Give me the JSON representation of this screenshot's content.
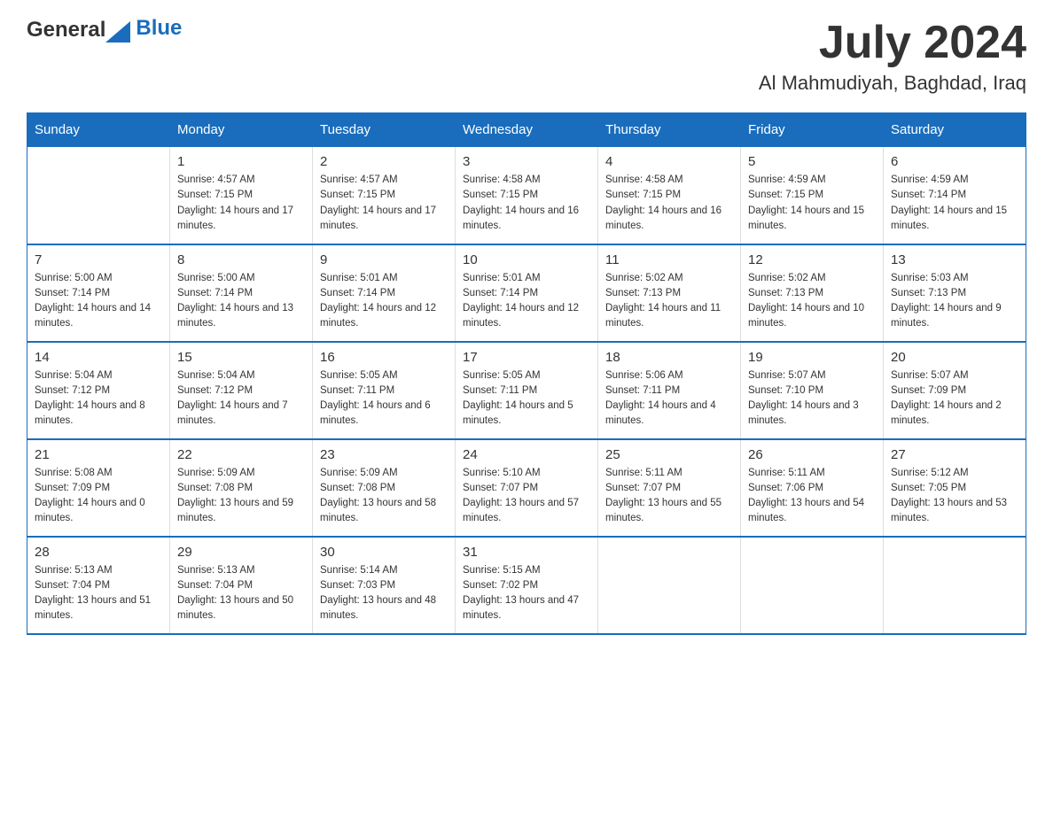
{
  "header": {
    "logo_general": "General",
    "logo_blue": "Blue",
    "month_year": "July 2024",
    "location": "Al Mahmudiyah, Baghdad, Iraq"
  },
  "days_of_week": [
    "Sunday",
    "Monday",
    "Tuesday",
    "Wednesday",
    "Thursday",
    "Friday",
    "Saturday"
  ],
  "weeks": [
    [
      {
        "day": "",
        "sunrise": "",
        "sunset": "",
        "daylight": ""
      },
      {
        "day": "1",
        "sunrise": "Sunrise: 4:57 AM",
        "sunset": "Sunset: 7:15 PM",
        "daylight": "Daylight: 14 hours and 17 minutes."
      },
      {
        "day": "2",
        "sunrise": "Sunrise: 4:57 AM",
        "sunset": "Sunset: 7:15 PM",
        "daylight": "Daylight: 14 hours and 17 minutes."
      },
      {
        "day": "3",
        "sunrise": "Sunrise: 4:58 AM",
        "sunset": "Sunset: 7:15 PM",
        "daylight": "Daylight: 14 hours and 16 minutes."
      },
      {
        "day": "4",
        "sunrise": "Sunrise: 4:58 AM",
        "sunset": "Sunset: 7:15 PM",
        "daylight": "Daylight: 14 hours and 16 minutes."
      },
      {
        "day": "5",
        "sunrise": "Sunrise: 4:59 AM",
        "sunset": "Sunset: 7:15 PM",
        "daylight": "Daylight: 14 hours and 15 minutes."
      },
      {
        "day": "6",
        "sunrise": "Sunrise: 4:59 AM",
        "sunset": "Sunset: 7:14 PM",
        "daylight": "Daylight: 14 hours and 15 minutes."
      }
    ],
    [
      {
        "day": "7",
        "sunrise": "Sunrise: 5:00 AM",
        "sunset": "Sunset: 7:14 PM",
        "daylight": "Daylight: 14 hours and 14 minutes."
      },
      {
        "day": "8",
        "sunrise": "Sunrise: 5:00 AM",
        "sunset": "Sunset: 7:14 PM",
        "daylight": "Daylight: 14 hours and 13 minutes."
      },
      {
        "day": "9",
        "sunrise": "Sunrise: 5:01 AM",
        "sunset": "Sunset: 7:14 PM",
        "daylight": "Daylight: 14 hours and 12 minutes."
      },
      {
        "day": "10",
        "sunrise": "Sunrise: 5:01 AM",
        "sunset": "Sunset: 7:14 PM",
        "daylight": "Daylight: 14 hours and 12 minutes."
      },
      {
        "day": "11",
        "sunrise": "Sunrise: 5:02 AM",
        "sunset": "Sunset: 7:13 PM",
        "daylight": "Daylight: 14 hours and 11 minutes."
      },
      {
        "day": "12",
        "sunrise": "Sunrise: 5:02 AM",
        "sunset": "Sunset: 7:13 PM",
        "daylight": "Daylight: 14 hours and 10 minutes."
      },
      {
        "day": "13",
        "sunrise": "Sunrise: 5:03 AM",
        "sunset": "Sunset: 7:13 PM",
        "daylight": "Daylight: 14 hours and 9 minutes."
      }
    ],
    [
      {
        "day": "14",
        "sunrise": "Sunrise: 5:04 AM",
        "sunset": "Sunset: 7:12 PM",
        "daylight": "Daylight: 14 hours and 8 minutes."
      },
      {
        "day": "15",
        "sunrise": "Sunrise: 5:04 AM",
        "sunset": "Sunset: 7:12 PM",
        "daylight": "Daylight: 14 hours and 7 minutes."
      },
      {
        "day": "16",
        "sunrise": "Sunrise: 5:05 AM",
        "sunset": "Sunset: 7:11 PM",
        "daylight": "Daylight: 14 hours and 6 minutes."
      },
      {
        "day": "17",
        "sunrise": "Sunrise: 5:05 AM",
        "sunset": "Sunset: 7:11 PM",
        "daylight": "Daylight: 14 hours and 5 minutes."
      },
      {
        "day": "18",
        "sunrise": "Sunrise: 5:06 AM",
        "sunset": "Sunset: 7:11 PM",
        "daylight": "Daylight: 14 hours and 4 minutes."
      },
      {
        "day": "19",
        "sunrise": "Sunrise: 5:07 AM",
        "sunset": "Sunset: 7:10 PM",
        "daylight": "Daylight: 14 hours and 3 minutes."
      },
      {
        "day": "20",
        "sunrise": "Sunrise: 5:07 AM",
        "sunset": "Sunset: 7:09 PM",
        "daylight": "Daylight: 14 hours and 2 minutes."
      }
    ],
    [
      {
        "day": "21",
        "sunrise": "Sunrise: 5:08 AM",
        "sunset": "Sunset: 7:09 PM",
        "daylight": "Daylight: 14 hours and 0 minutes."
      },
      {
        "day": "22",
        "sunrise": "Sunrise: 5:09 AM",
        "sunset": "Sunset: 7:08 PM",
        "daylight": "Daylight: 13 hours and 59 minutes."
      },
      {
        "day": "23",
        "sunrise": "Sunrise: 5:09 AM",
        "sunset": "Sunset: 7:08 PM",
        "daylight": "Daylight: 13 hours and 58 minutes."
      },
      {
        "day": "24",
        "sunrise": "Sunrise: 5:10 AM",
        "sunset": "Sunset: 7:07 PM",
        "daylight": "Daylight: 13 hours and 57 minutes."
      },
      {
        "day": "25",
        "sunrise": "Sunrise: 5:11 AM",
        "sunset": "Sunset: 7:07 PM",
        "daylight": "Daylight: 13 hours and 55 minutes."
      },
      {
        "day": "26",
        "sunrise": "Sunrise: 5:11 AM",
        "sunset": "Sunset: 7:06 PM",
        "daylight": "Daylight: 13 hours and 54 minutes."
      },
      {
        "day": "27",
        "sunrise": "Sunrise: 5:12 AM",
        "sunset": "Sunset: 7:05 PM",
        "daylight": "Daylight: 13 hours and 53 minutes."
      }
    ],
    [
      {
        "day": "28",
        "sunrise": "Sunrise: 5:13 AM",
        "sunset": "Sunset: 7:04 PM",
        "daylight": "Daylight: 13 hours and 51 minutes."
      },
      {
        "day": "29",
        "sunrise": "Sunrise: 5:13 AM",
        "sunset": "Sunset: 7:04 PM",
        "daylight": "Daylight: 13 hours and 50 minutes."
      },
      {
        "day": "30",
        "sunrise": "Sunrise: 5:14 AM",
        "sunset": "Sunset: 7:03 PM",
        "daylight": "Daylight: 13 hours and 48 minutes."
      },
      {
        "day": "31",
        "sunrise": "Sunrise: 5:15 AM",
        "sunset": "Sunset: 7:02 PM",
        "daylight": "Daylight: 13 hours and 47 minutes."
      },
      {
        "day": "",
        "sunrise": "",
        "sunset": "",
        "daylight": ""
      },
      {
        "day": "",
        "sunrise": "",
        "sunset": "",
        "daylight": ""
      },
      {
        "day": "",
        "sunrise": "",
        "sunset": "",
        "daylight": ""
      }
    ]
  ]
}
